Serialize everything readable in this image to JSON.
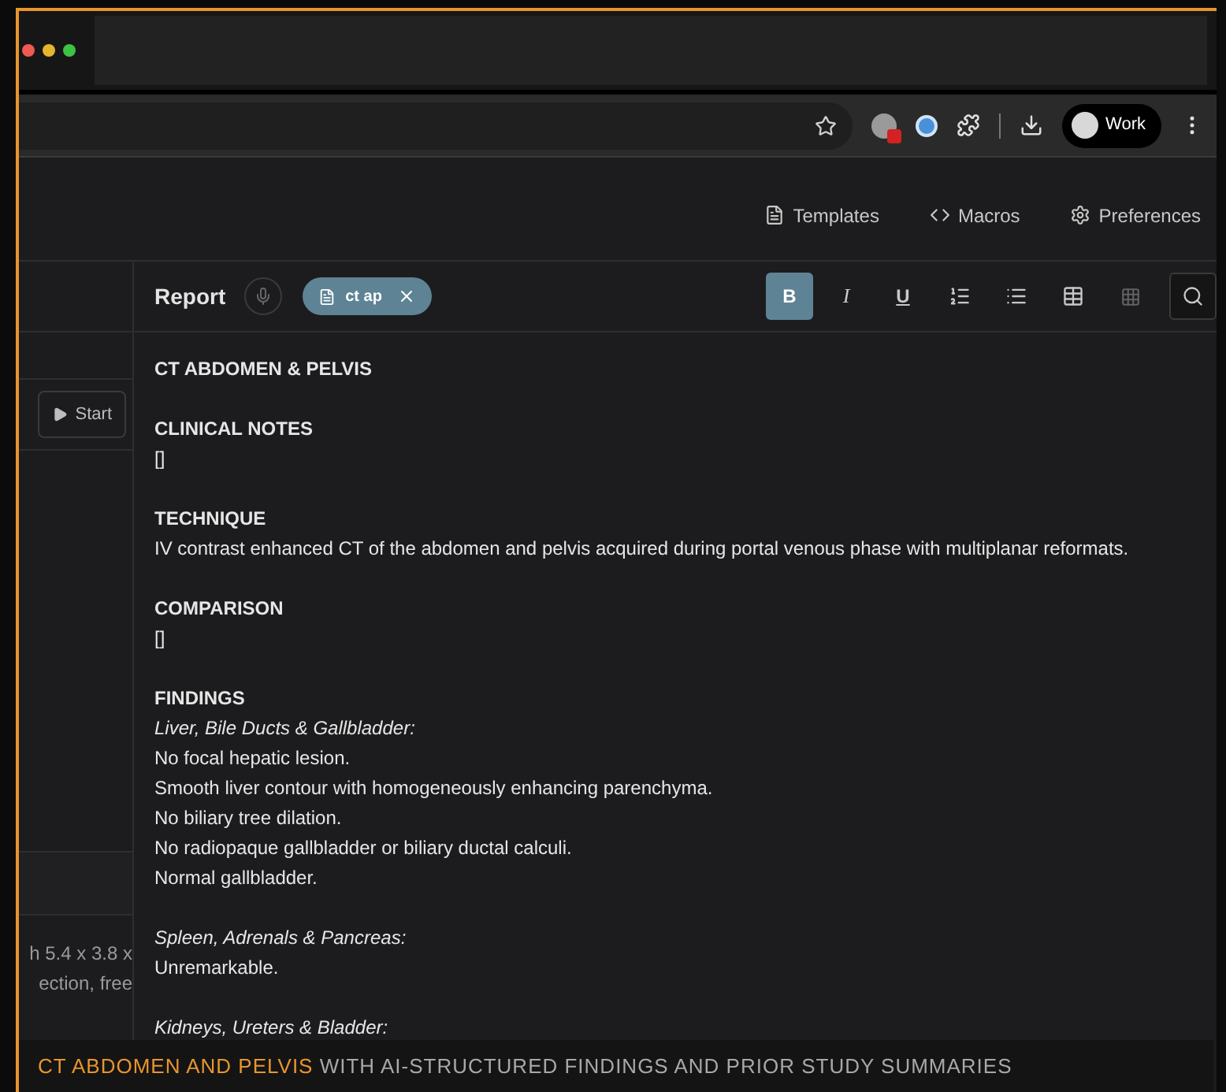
{
  "browser": {
    "profile": "Work"
  },
  "nav": [
    {
      "kind": "templates",
      "label": "Templates"
    },
    {
      "kind": "macros",
      "label": "Macros"
    },
    {
      "kind": "preferences",
      "label": "Preferences"
    }
  ],
  "left_panel": {
    "start_button": "Start",
    "snippet_lines": [
      "h 5.4 x 3.8 x",
      "ection, free"
    ]
  },
  "report": {
    "title": "Report",
    "chip": {
      "label": "ct ap"
    },
    "toolbar": [
      {
        "kind": "bold",
        "label": "B",
        "selected": true,
        "disabled": false
      },
      {
        "kind": "italic",
        "label": "I",
        "selected": false,
        "disabled": false
      },
      {
        "kind": "underline",
        "label": "U",
        "selected": false,
        "disabled": false
      },
      {
        "kind": "ordered-list",
        "selected": false,
        "disabled": false
      },
      {
        "kind": "bullet-list",
        "selected": false,
        "disabled": false
      },
      {
        "kind": "table",
        "selected": false,
        "disabled": false
      },
      {
        "kind": "cells",
        "selected": false,
        "disabled": true
      },
      {
        "kind": "search",
        "selected": false,
        "disabled": false
      }
    ],
    "doc_title": "CT ABDOMEN & PELVIS",
    "sections": [
      {
        "heading": "CLINICAL NOTES",
        "groups": [
          {
            "lines": [
              "[]"
            ]
          }
        ]
      },
      {
        "heading": "TECHNIQUE",
        "groups": [
          {
            "lines": [
              "IV contrast enhanced CT of the abdomen and pelvis acquired during portal venous phase with multiplanar reformats."
            ]
          }
        ]
      },
      {
        "heading": "COMPARISON",
        "groups": [
          {
            "lines": [
              "[]"
            ]
          }
        ]
      },
      {
        "heading": "FINDINGS",
        "groups": [
          {
            "subheading": "Liver, Bile Ducts & Gallbladder:",
            "lines": [
              "No focal hepatic lesion.",
              "Smooth liver contour with homogeneously enhancing parenchyma.",
              "No biliary tree dilation.",
              "No radiopaque gallbladder or biliary ductal calculi.",
              "Normal gallbladder."
            ]
          },
          {
            "subheading": "Spleen, Adrenals & Pancreas:",
            "lines": [
              "Unremarkable."
            ]
          },
          {
            "subheading": "Kidneys, Ureters & Bladder:"
          }
        ]
      }
    ]
  },
  "caption": {
    "highlight": "CT ABDOMEN AND PELVIS",
    "rest": "WITH AI-STRUCTURED FINDINGS AND PRIOR STUDY SUMMARIES"
  }
}
